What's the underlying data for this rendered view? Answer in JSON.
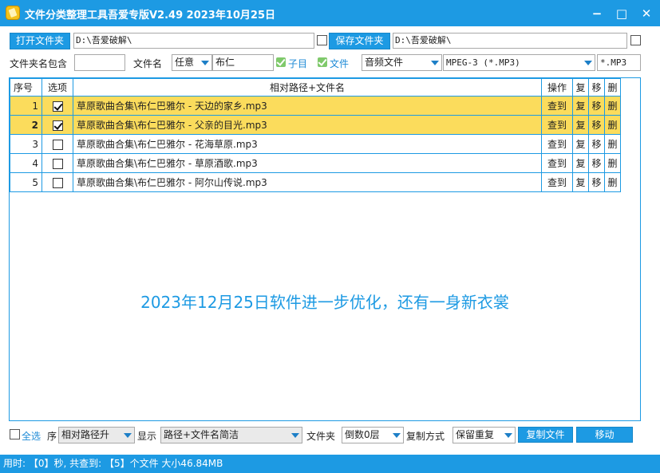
{
  "window": {
    "title": "文件分类整理工具吾爱专版V2.49  2023年10月25日",
    "minimize": "−",
    "maximize": "□",
    "close": "✕"
  },
  "toolbar1": {
    "open_folder_label": "打开文件夹",
    "open_folder_value": "D:\\吾爱破解\\",
    "save_folder_label": "保存文件夹",
    "save_folder_value": "D:\\吾爱破解\\"
  },
  "toolbar2": {
    "folder_contains_label": "文件夹名包含",
    "folder_contains_value": "",
    "filename_label": "文件名",
    "filename_mode": "任意",
    "filename_value": "布仁",
    "subdir_label": "子目",
    "file_label": "文件",
    "filetype": "音频文件",
    "format": "MPEG-3 (*.MP3)",
    "extension": "*.MP3"
  },
  "table": {
    "headers": {
      "no": "序号",
      "option": "选项",
      "path": "相对路径+文件名",
      "action": "操作",
      "copy": "复",
      "move": "移",
      "delete": "删"
    },
    "rows": [
      {
        "no": "1",
        "checked": true,
        "path": "草原歌曲合集\\布仁巴雅尔 - 天边的家乡.mp3",
        "action": "查到",
        "copy": "复",
        "move": "移",
        "delete": "删"
      },
      {
        "no": "2",
        "checked": true,
        "path": "草原歌曲合集\\布仁巴雅尔 - 父亲的目光.mp3",
        "action": "查到",
        "copy": "复",
        "move": "移",
        "delete": "删"
      },
      {
        "no": "3",
        "checked": false,
        "path": "草原歌曲合集\\布仁巴雅尔 - 花海草原.mp3",
        "action": "查到",
        "copy": "复",
        "move": "移",
        "delete": "删"
      },
      {
        "no": "4",
        "checked": false,
        "path": "草原歌曲合集\\布仁巴雅尔 - 草原酒歌.mp3",
        "action": "查到",
        "copy": "复",
        "move": "移",
        "delete": "删"
      },
      {
        "no": "5",
        "checked": false,
        "path": "草原歌曲合集\\布仁巴雅尔 - 阿尔山传说.mp3",
        "action": "查到",
        "copy": "复",
        "move": "移",
        "delete": "删"
      }
    ]
  },
  "watermark": "2023年12月25日软件进一步优化，还有一身新衣裳",
  "bottom": {
    "select_all": "全选",
    "sort_label": "序",
    "sort_value": "相对路径升",
    "display_label": "显示",
    "display_value": "路径+文件名简洁",
    "folder_label": "文件夹",
    "folder_level": "倒数0层",
    "copy_mode_label": "复制方式",
    "copy_mode_value": "保留重复",
    "copy_button": "复制文件",
    "move_button": "移动"
  },
  "status": "用时: 【0】秒, 共查到: 【5】个文件  大小46.84MB",
  "colors": {
    "accent": "#1d9ae3",
    "selected_row": "#fbdc5c",
    "check_green": "#7fc96b"
  }
}
